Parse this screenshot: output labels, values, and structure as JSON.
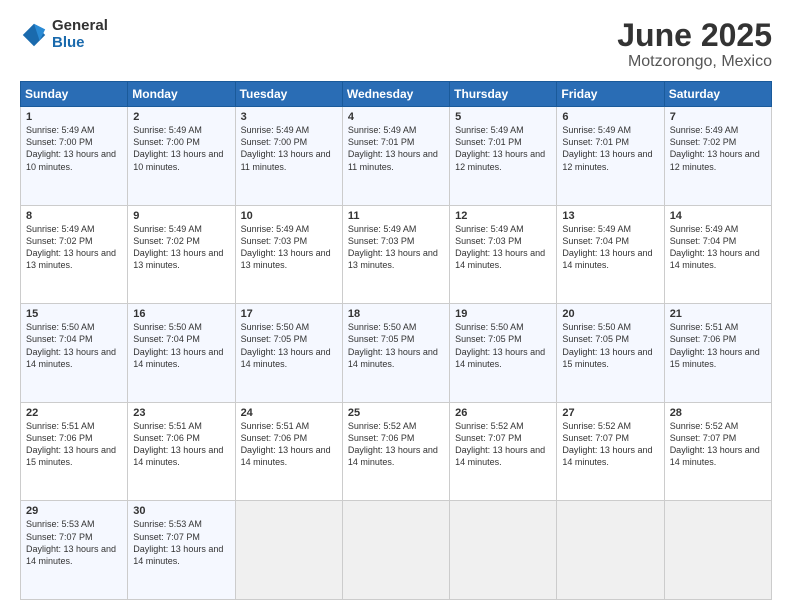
{
  "logo": {
    "general": "General",
    "blue": "Blue"
  },
  "title": "June 2025",
  "subtitle": "Motzorongo, Mexico",
  "days": [
    "Sunday",
    "Monday",
    "Tuesday",
    "Wednesday",
    "Thursday",
    "Friday",
    "Saturday"
  ],
  "weeks": [
    [
      {
        "day": "1",
        "sunrise": "5:49 AM",
        "sunset": "7:00 PM",
        "daylight": "13 hours and 10 minutes."
      },
      {
        "day": "2",
        "sunrise": "5:49 AM",
        "sunset": "7:00 PM",
        "daylight": "13 hours and 10 minutes."
      },
      {
        "day": "3",
        "sunrise": "5:49 AM",
        "sunset": "7:00 PM",
        "daylight": "13 hours and 11 minutes."
      },
      {
        "day": "4",
        "sunrise": "5:49 AM",
        "sunset": "7:01 PM",
        "daylight": "13 hours and 11 minutes."
      },
      {
        "day": "5",
        "sunrise": "5:49 AM",
        "sunset": "7:01 PM",
        "daylight": "13 hours and 12 minutes."
      },
      {
        "day": "6",
        "sunrise": "5:49 AM",
        "sunset": "7:01 PM",
        "daylight": "13 hours and 12 minutes."
      },
      {
        "day": "7",
        "sunrise": "5:49 AM",
        "sunset": "7:02 PM",
        "daylight": "13 hours and 12 minutes."
      }
    ],
    [
      {
        "day": "8",
        "sunrise": "5:49 AM",
        "sunset": "7:02 PM",
        "daylight": "13 hours and 13 minutes."
      },
      {
        "day": "9",
        "sunrise": "5:49 AM",
        "sunset": "7:02 PM",
        "daylight": "13 hours and 13 minutes."
      },
      {
        "day": "10",
        "sunrise": "5:49 AM",
        "sunset": "7:03 PM",
        "daylight": "13 hours and 13 minutes."
      },
      {
        "day": "11",
        "sunrise": "5:49 AM",
        "sunset": "7:03 PM",
        "daylight": "13 hours and 13 minutes."
      },
      {
        "day": "12",
        "sunrise": "5:49 AM",
        "sunset": "7:03 PM",
        "daylight": "13 hours and 14 minutes."
      },
      {
        "day": "13",
        "sunrise": "5:49 AM",
        "sunset": "7:04 PM",
        "daylight": "13 hours and 14 minutes."
      },
      {
        "day": "14",
        "sunrise": "5:49 AM",
        "sunset": "7:04 PM",
        "daylight": "13 hours and 14 minutes."
      }
    ],
    [
      {
        "day": "15",
        "sunrise": "5:50 AM",
        "sunset": "7:04 PM",
        "daylight": "13 hours and 14 minutes."
      },
      {
        "day": "16",
        "sunrise": "5:50 AM",
        "sunset": "7:04 PM",
        "daylight": "13 hours and 14 minutes."
      },
      {
        "day": "17",
        "sunrise": "5:50 AM",
        "sunset": "7:05 PM",
        "daylight": "13 hours and 14 minutes."
      },
      {
        "day": "18",
        "sunrise": "5:50 AM",
        "sunset": "7:05 PM",
        "daylight": "13 hours and 14 minutes."
      },
      {
        "day": "19",
        "sunrise": "5:50 AM",
        "sunset": "7:05 PM",
        "daylight": "13 hours and 14 minutes."
      },
      {
        "day": "20",
        "sunrise": "5:50 AM",
        "sunset": "7:05 PM",
        "daylight": "13 hours and 15 minutes."
      },
      {
        "day": "21",
        "sunrise": "5:51 AM",
        "sunset": "7:06 PM",
        "daylight": "13 hours and 15 minutes."
      }
    ],
    [
      {
        "day": "22",
        "sunrise": "5:51 AM",
        "sunset": "7:06 PM",
        "daylight": "13 hours and 15 minutes."
      },
      {
        "day": "23",
        "sunrise": "5:51 AM",
        "sunset": "7:06 PM",
        "daylight": "13 hours and 14 minutes."
      },
      {
        "day": "24",
        "sunrise": "5:51 AM",
        "sunset": "7:06 PM",
        "daylight": "13 hours and 14 minutes."
      },
      {
        "day": "25",
        "sunrise": "5:52 AM",
        "sunset": "7:06 PM",
        "daylight": "13 hours and 14 minutes."
      },
      {
        "day": "26",
        "sunrise": "5:52 AM",
        "sunset": "7:07 PM",
        "daylight": "13 hours and 14 minutes."
      },
      {
        "day": "27",
        "sunrise": "5:52 AM",
        "sunset": "7:07 PM",
        "daylight": "13 hours and 14 minutes."
      },
      {
        "day": "28",
        "sunrise": "5:52 AM",
        "sunset": "7:07 PM",
        "daylight": "13 hours and 14 minutes."
      }
    ],
    [
      {
        "day": "29",
        "sunrise": "5:53 AM",
        "sunset": "7:07 PM",
        "daylight": "13 hours and 14 minutes."
      },
      {
        "day": "30",
        "sunrise": "5:53 AM",
        "sunset": "7:07 PM",
        "daylight": "13 hours and 14 minutes."
      },
      null,
      null,
      null,
      null,
      null
    ]
  ]
}
